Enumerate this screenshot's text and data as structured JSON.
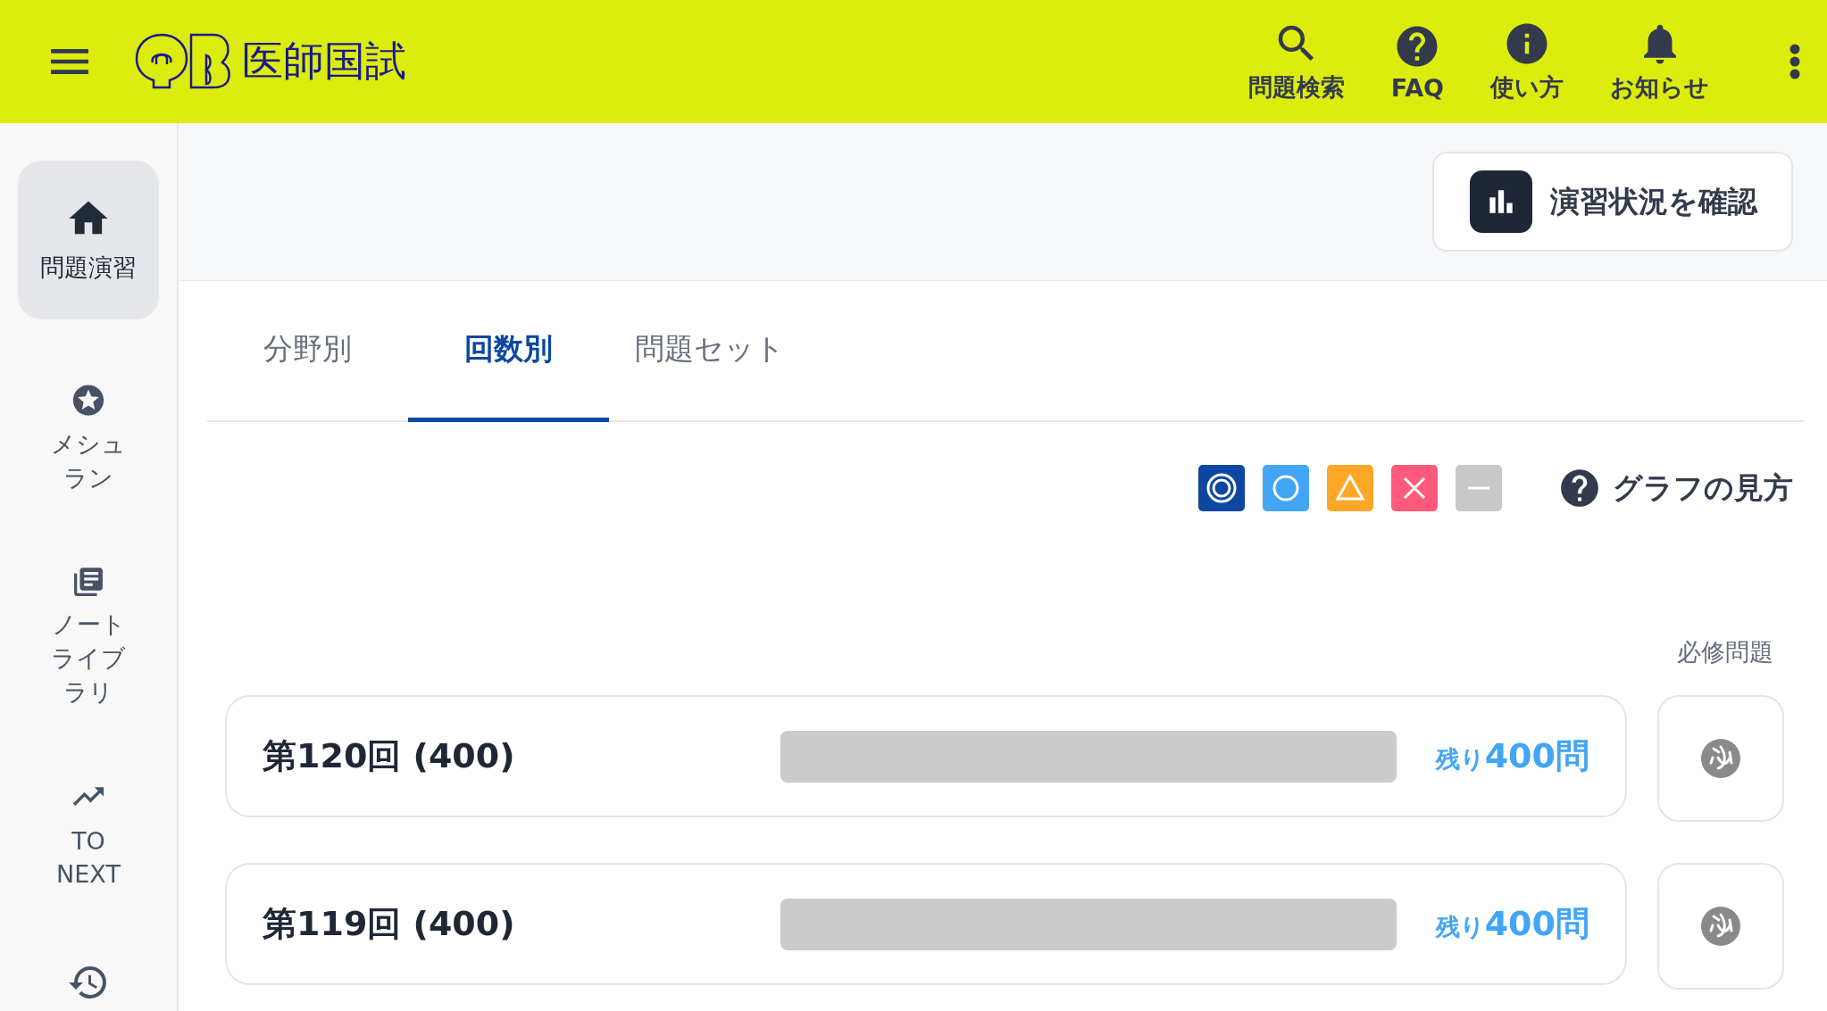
{
  "header": {
    "logo_text": "医師国試",
    "actions": [
      {
        "kind": "search",
        "label": "問題検索"
      },
      {
        "kind": "help",
        "label": "FAQ"
      },
      {
        "kind": "info",
        "label": "使い方"
      },
      {
        "kind": "bell",
        "label": "お知らせ"
      }
    ]
  },
  "sidebar": {
    "items": [
      {
        "kind": "home",
        "label": "問題演習",
        "selected": true
      },
      {
        "kind": "star",
        "label": "メシュラン",
        "selected": false
      },
      {
        "kind": "library",
        "label": "ノートライブラリ",
        "selected": false
      },
      {
        "kind": "trend",
        "label": "TO NEXT",
        "selected": false
      },
      {
        "kind": "history",
        "selected": false
      }
    ]
  },
  "status_button": {
    "label": "演習状況を確認"
  },
  "tabs": [
    {
      "label": "分野別",
      "selected": false
    },
    {
      "label": "回数別",
      "selected": true
    },
    {
      "label": "問題セット",
      "selected": false
    }
  ],
  "legend": {
    "items": [
      {
        "kind": "double-circle",
        "color": "#0d47a1"
      },
      {
        "kind": "circle",
        "color": "#42a5f5"
      },
      {
        "kind": "triangle",
        "color": "#ffa726"
      },
      {
        "kind": "cross",
        "color": "#ff5a7a"
      },
      {
        "kind": "dash",
        "color": "#c8c8c8"
      }
    ],
    "help_label": "グラフの見方"
  },
  "required_heading": "必修問題",
  "rows": [
    {
      "title": "第120回 (400)",
      "remaining_prefix": "残り",
      "remaining": "400問"
    },
    {
      "title": "第119回 (400)",
      "remaining_prefix": "残り",
      "remaining": "400問"
    }
  ]
}
